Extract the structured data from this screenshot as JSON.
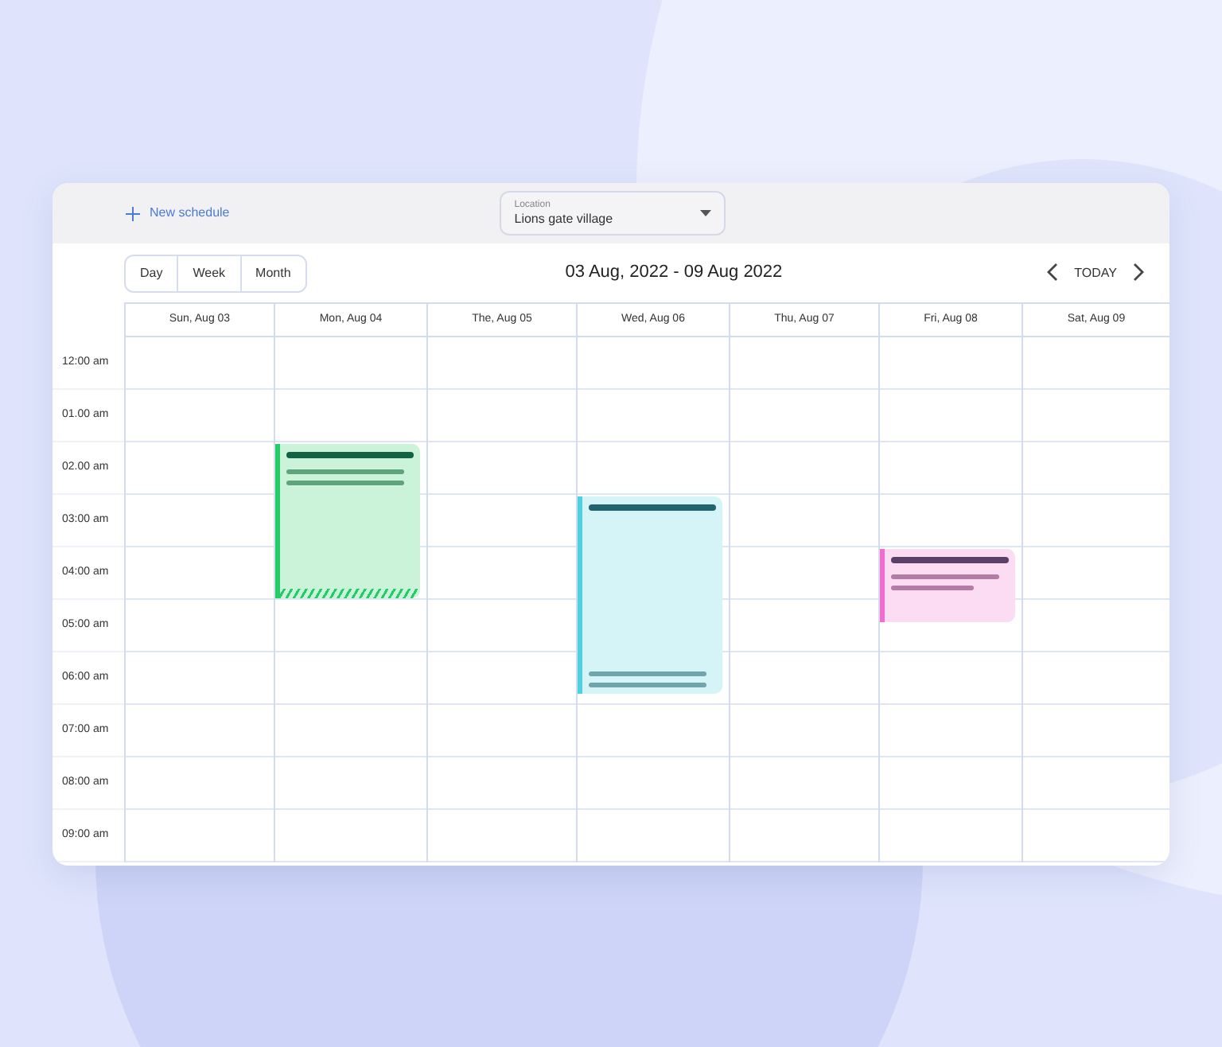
{
  "toolbar": {
    "new_button": "New schedule",
    "location": {
      "label": "Location",
      "value": "Lions gate village"
    }
  },
  "views": [
    {
      "label": "Day",
      "selected": false
    },
    {
      "label": "Week",
      "selected": false
    },
    {
      "label": "Month",
      "selected": false
    }
  ],
  "range_title": "03 Aug, 2022 - 09 Aug 2022",
  "today_button": "TODAY",
  "times": [
    "12:00 am",
    "01.00 am",
    "02.00 am",
    "03:00 am",
    "04:00 am",
    "05:00 am",
    "06:00 am",
    "07:00 am",
    "08:00 am",
    "09:00 am"
  ],
  "days": [
    {
      "label": "Sun, Aug 03",
      "hours": [
        {
          "booked": false
        },
        {
          "booked": false
        },
        {
          "booked": false
        },
        {
          "booked": false
        },
        {
          "booked": false
        },
        {
          "booked": false
        },
        {
          "booked": false
        },
        {
          "booked": false
        },
        {
          "booked": false
        },
        {
          "booked": false
        }
      ]
    },
    {
      "label": "Mon, Aug 04",
      "event": {
        "color": "#22cc66",
        "kind": "top",
        "hatched": true
      },
      "hours": [
        {
          "booked": false
        },
        {
          "booked": false
        },
        {
          "booked": true
        },
        {
          "booked": true
        },
        {
          "booked": true
        },
        {
          "booked": false
        },
        {
          "booked": false
        },
        {
          "booked": false
        },
        {
          "booked": false
        },
        {
          "booked": false
        }
      ]
    },
    {
      "label": "The, Aug 05",
      "hours": [
        {
          "booked": false
        },
        {
          "booked": false
        },
        {
          "booked": false
        },
        {
          "booked": false
        },
        {
          "booked": false
        },
        {
          "booked": false
        },
        {
          "booked": false
        },
        {
          "booked": false
        },
        {
          "booked": false
        },
        {
          "booked": false
        }
      ]
    },
    {
      "label": "Wed, Aug 06",
      "event": {
        "color": "#4dd0e1",
        "kind": "split",
        "hatched": false
      },
      "hours": [
        {
          "booked": false
        },
        {
          "booked": false
        },
        {
          "booked": false
        },
        {
          "booked": true
        },
        {
          "booked": true
        },
        {
          "booked": true
        },
        {
          "booked": true
        },
        {
          "booked": false
        },
        {
          "booked": false
        },
        {
          "booked": false
        }
      ]
    },
    {
      "label": "Thu, Aug 07",
      "hours": [
        {
          "booked": false
        },
        {
          "booked": false
        },
        {
          "booked": false
        },
        {
          "booked": false
        },
        {
          "booked": false
        },
        {
          "booked": false
        },
        {
          "booked": false
        },
        {
          "booked": false
        },
        {
          "booked": false
        },
        {
          "booked": false
        }
      ]
    },
    {
      "label": "Fri, Aug 08",
      "event": {
        "color": "#f06ccf",
        "kind": "top",
        "hatched": false
      },
      "hours": [
        {
          "booked": false
        },
        {
          "booked": false
        },
        {
          "booked": false
        },
        {
          "booked": false
        },
        {
          "booked": true
        },
        {
          "booked": true
        },
        {
          "booked": false
        },
        {
          "booked": false
        },
        {
          "booked": false
        },
        {
          "booked": false
        }
      ]
    },
    {
      "label": "Sat, Aug 09",
      "hours": [
        {
          "booked": false
        },
        {
          "booked": false
        },
        {
          "booked": false
        },
        {
          "booked": false
        },
        {
          "booked": false
        },
        {
          "booked": false
        },
        {
          "booked": false
        },
        {
          "booked": false
        },
        {
          "booked": false
        },
        {
          "booked": false
        }
      ]
    }
  ]
}
